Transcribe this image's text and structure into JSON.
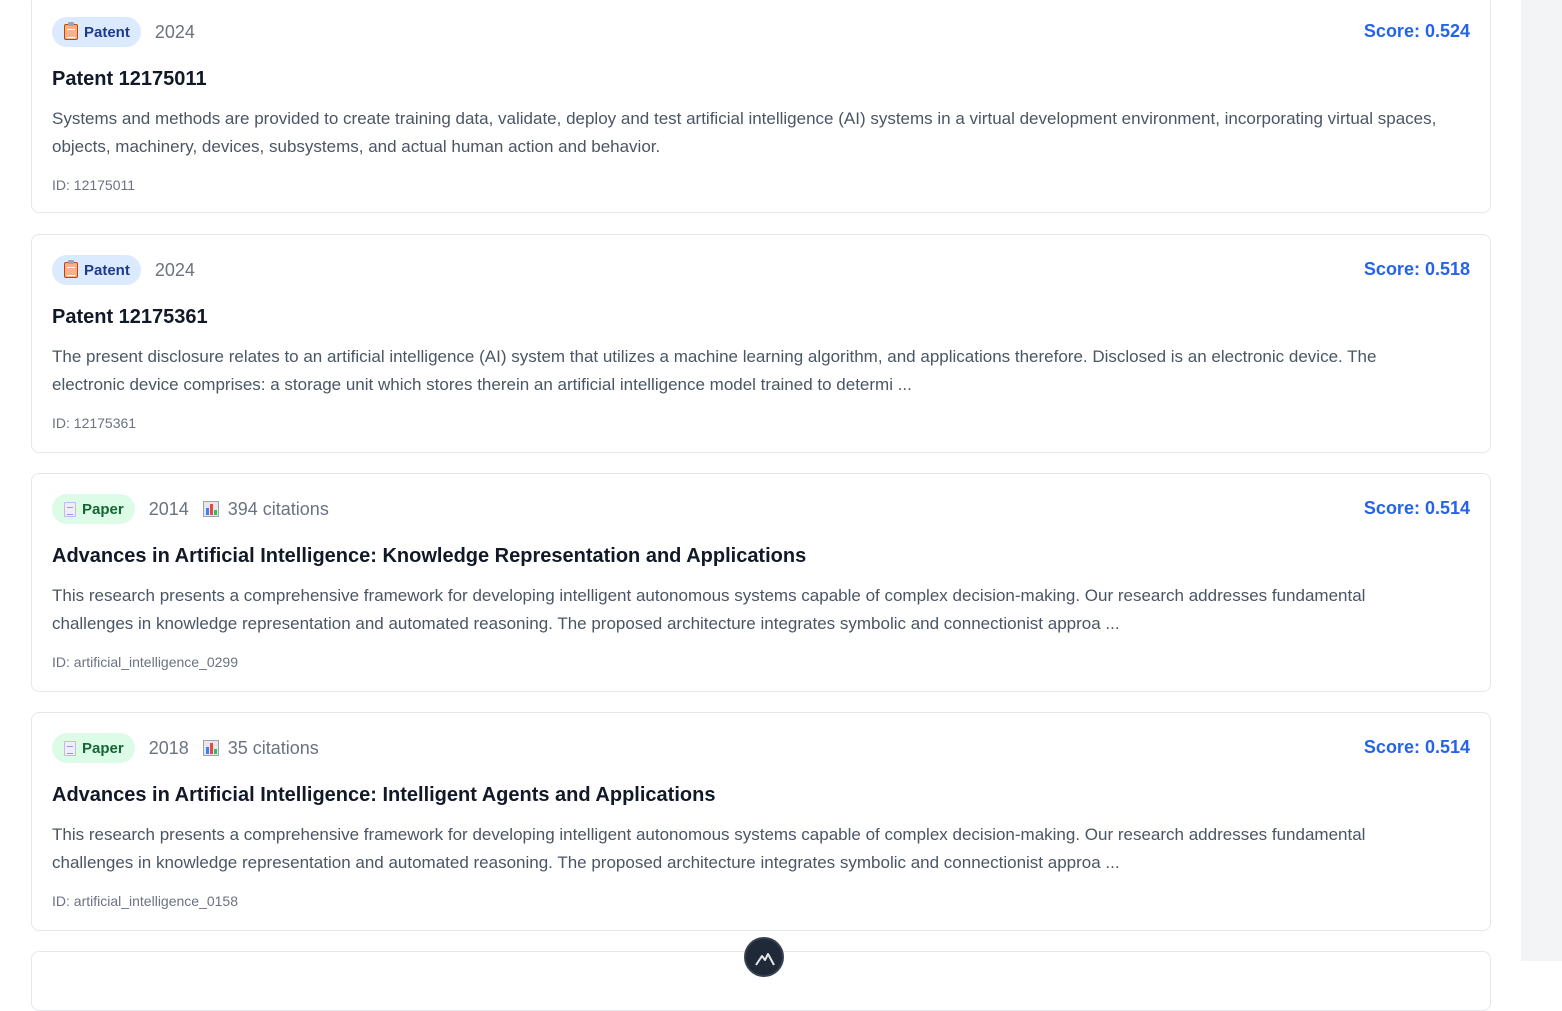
{
  "results": [
    {
      "type": "Patent",
      "year": "2024",
      "citations": null,
      "score": "Score: 0.524",
      "title": "Patent 12175011",
      "abstract": "Systems and methods are provided to create training data, validate, deploy and test artificial intelligence (AI) systems in a virtual development environment, incorporating virtual spaces, objects, machinery, devices, subsystems, and actual human action and behavior.",
      "id": "ID: 12175011",
      "icon": "clipboard-icon"
    },
    {
      "type": "Patent",
      "year": "2024",
      "citations": null,
      "score": "Score: 0.518",
      "title": "Patent 12175361",
      "abstract": "The present disclosure relates to an artificial intelligence (AI) system that utilizes a machine learning algorithm, and applications therefore. Disclosed is an electronic device. The electronic device comprises: a storage unit which stores therein an artificial intelligence model trained to determi ...",
      "id": "ID: 12175361",
      "icon": "clipboard-icon"
    },
    {
      "type": "Paper",
      "year": "2014",
      "citations": "394 citations",
      "score": "Score: 0.514",
      "title": "Advances in Artificial Intelligence: Knowledge Representation and Applications",
      "abstract": "This research presents a comprehensive framework for developing intelligent autonomous systems capable of complex decision-making. Our research addresses fundamental challenges in knowledge representation and automated reasoning. The proposed architecture integrates symbolic and connectionist approa ...",
      "id": "ID: artificial_intelligence_0299",
      "icon": "page-icon"
    },
    {
      "type": "Paper",
      "year": "2018",
      "citations": "35 citations",
      "score": "Score: 0.514",
      "title": "Advances in Artificial Intelligence: Intelligent Agents and Applications",
      "abstract": "This research presents a comprehensive framework for developing intelligent autonomous systems capable of complex decision-making. Our research addresses fundamental challenges in knowledge representation and automated reasoning. The proposed architecture integrates symbolic and connectionist approa ...",
      "id": "ID: artificial_intelligence_0158",
      "icon": "page-icon"
    }
  ],
  "colors": {
    "accent": "#2563eb",
    "patent_badge_bg": "#dbeafe",
    "paper_badge_bg": "#dcfce7",
    "card_border": "#e5e7eb"
  },
  "icons": {
    "citations": "bar-chart-icon",
    "fab": "mountain-logo-icon"
  }
}
